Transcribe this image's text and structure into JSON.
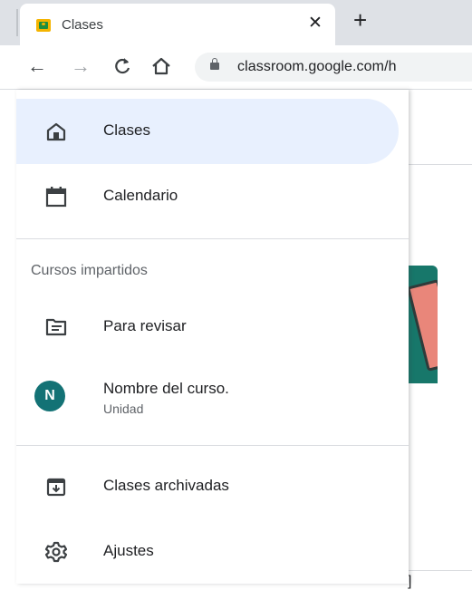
{
  "browser": {
    "tab_title": "Clases",
    "tab_close": "✕",
    "new_tab": "+",
    "back": "←",
    "forward": "→",
    "reload": "C",
    "url": "classroom.google.com/h"
  },
  "drawer": {
    "items": [
      {
        "label": "Clases",
        "icon": "home-icon",
        "active": true
      },
      {
        "label": "Calendario",
        "icon": "calendar-icon"
      }
    ],
    "section_title": "Cursos impartidos",
    "course_items": [
      {
        "label": "Para revisar",
        "icon": "assignment-review-icon"
      },
      {
        "label": "Nombre del curso.",
        "sublabel": "Unidad",
        "avatar": "N",
        "avatar_color": "#137275"
      }
    ],
    "footer_items": [
      {
        "label": "Clases archivadas",
        "icon": "archive-icon"
      },
      {
        "label": "Ajustes",
        "icon": "settings-icon"
      }
    ]
  },
  "colors": {
    "active_bg": "#e8f0fe",
    "avatar": "#137275",
    "card": "#17776a"
  }
}
